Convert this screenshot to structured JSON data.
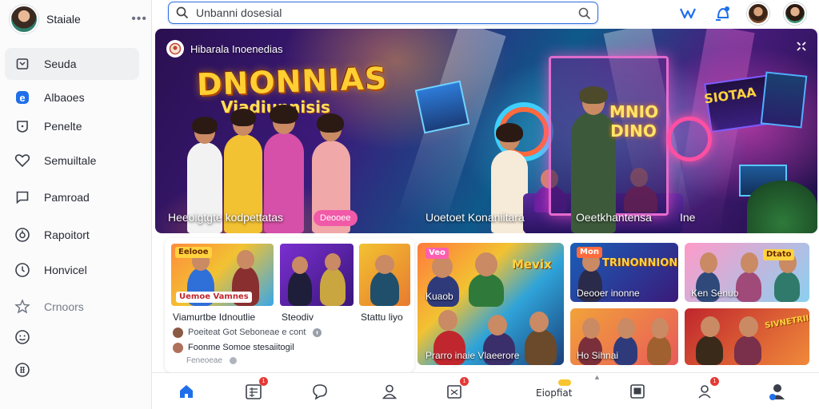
{
  "sidebar": {
    "profile_name": "Staiale",
    "more_label": "•••",
    "items": [
      {
        "label": "Seuda",
        "icon": "home-icon"
      },
      {
        "label": "Albaoes",
        "icon": "blue-e-icon"
      },
      {
        "label": "Penelte",
        "icon": "shield-icon"
      },
      {
        "label": "Semuiltale",
        "icon": "heart-icon"
      },
      {
        "label": "Pamroad",
        "icon": "chat-square-icon"
      },
      {
        "label": "Rapoitort",
        "icon": "info-circle-icon"
      },
      {
        "label": "Honvicel",
        "icon": "clock-icon"
      },
      {
        "label": "Crnoors",
        "icon": "star-icon"
      },
      {
        "label": "",
        "icon": "smiley-icon"
      },
      {
        "label": "",
        "icon": "grid-circle-icon"
      }
    ]
  },
  "search": {
    "placeholder": "Unbanni dosesial"
  },
  "hero": {
    "badge_text": "Hibarala Inoenedias",
    "title": "DNONNIAS",
    "subtitle": "Viadiunnisis",
    "booth_text": "MNIO DINO",
    "sign_text": "SIOTAA",
    "captions": [
      "Heeoigtgte kodpettatas",
      "Uoetoet Konaniitara",
      "Oeetkhantensa",
      "Ine"
    ],
    "pill": "Deooee"
  },
  "panel": {
    "thumbs": [
      {
        "label": "Viamurtbe Idnoutlie"
      },
      {
        "label": "Steodiv"
      },
      {
        "label": "Stattu liyo"
      }
    ],
    "thumb_chips": [
      "Eelooe",
      "Uemoe Vamnes"
    ],
    "meta": [
      "Poeiteat Got Seboneae e cont",
      "Foonme Somoe stesaiitogil",
      "Feneoeae"
    ]
  },
  "cards": [
    {
      "caption": "Kuaob",
      "title": "Mevix",
      "chip": "Veo"
    },
    {
      "caption": "Prarro inaie Vlaeerore",
      "title": ""
    },
    {
      "caption": "Deooer inonne",
      "title": "TRINONNION",
      "chip": "Mon"
    },
    {
      "caption": "Ken Senuo",
      "title": "",
      "chip": "Dtato"
    },
    {
      "caption": "Ho Sihnai",
      "title": ""
    },
    {
      "caption": "",
      "title": "SIVNETRII",
      "chip": ""
    }
  ],
  "bottom_nav": {
    "center_text": "Eiopfiat",
    "badge": "1",
    "items": [
      "home-icon",
      "grid-icon",
      "chat-icon",
      "profile-icon",
      "calendar-icon",
      "center-text",
      "gallery-icon",
      "user-alert-icon",
      "profile-icon"
    ]
  },
  "colors": {
    "accent": "#1f6feb",
    "badge": "#e53935",
    "pill": "#f05aa8"
  }
}
